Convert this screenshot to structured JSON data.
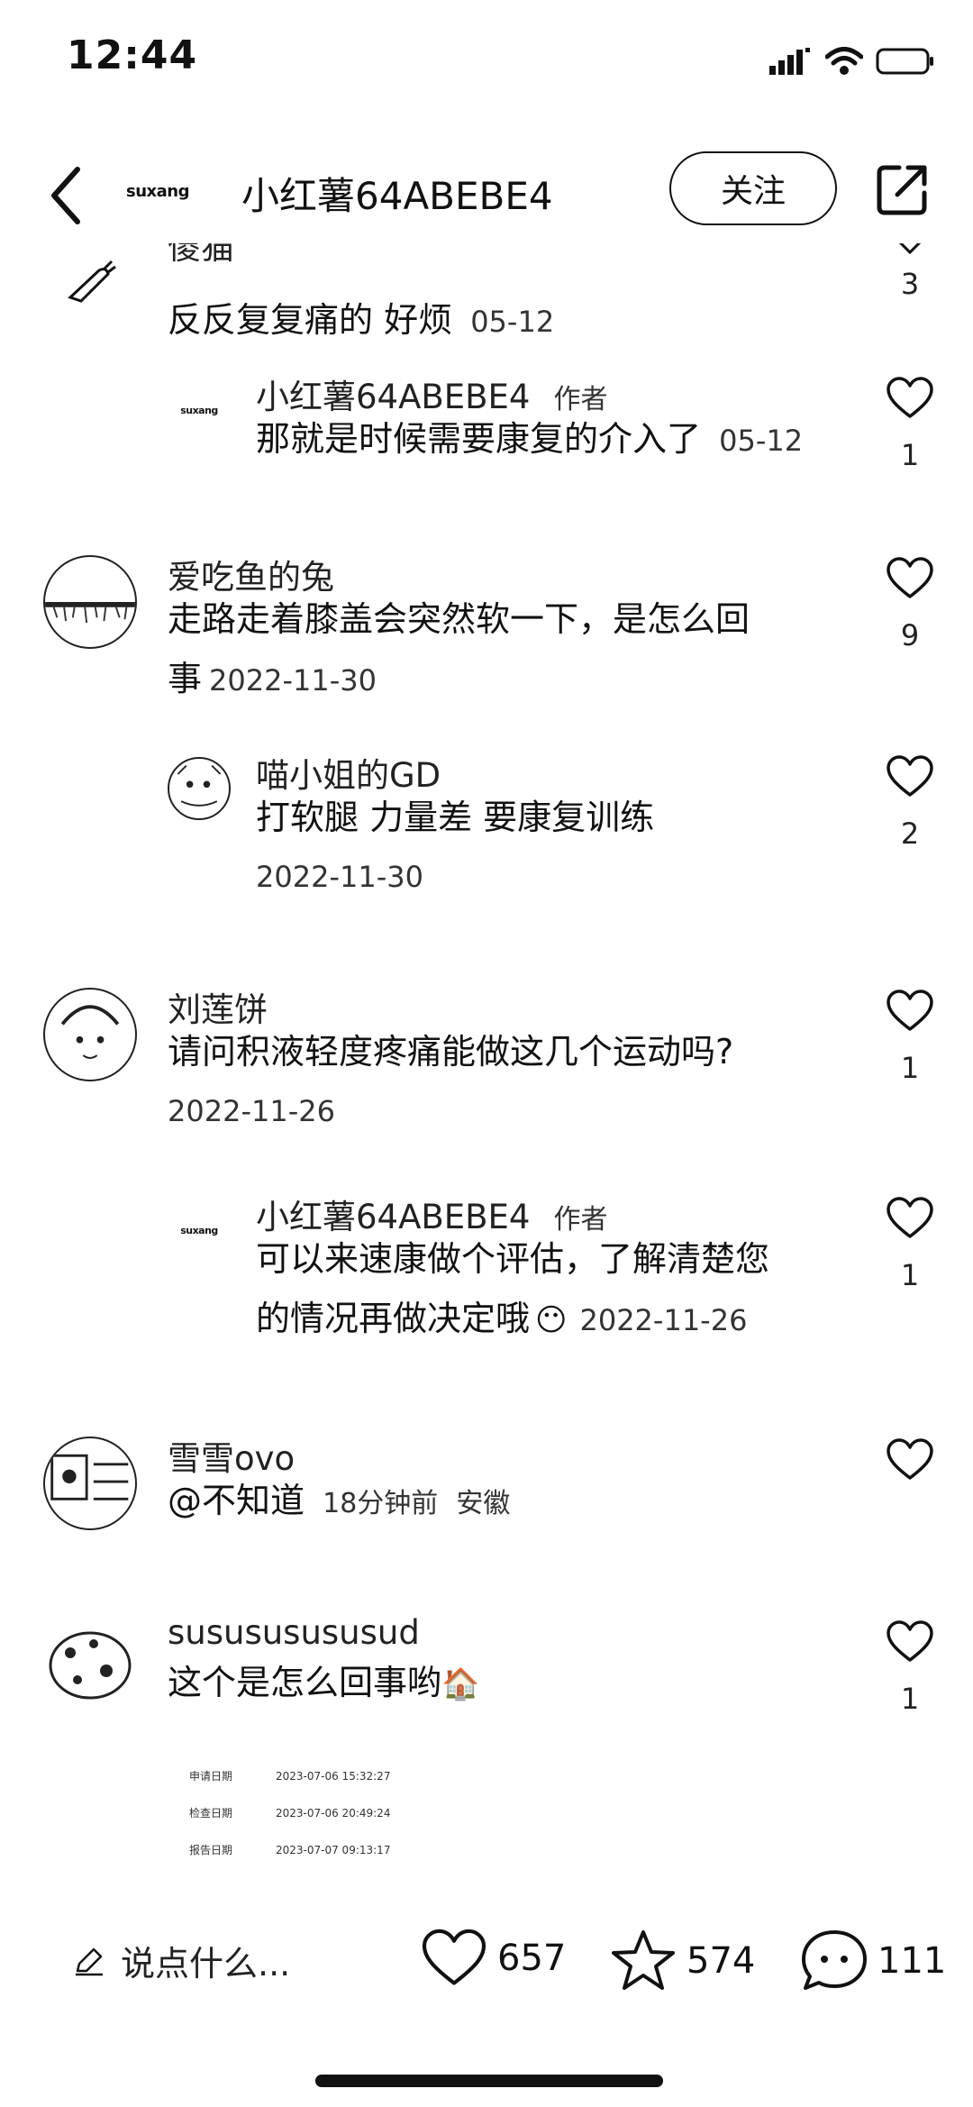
{
  "status_bar": {
    "time": "12:44"
  },
  "header": {
    "author_logo": "suxang",
    "author_name": "小红薯64ABEBE4",
    "follow_label": "关注"
  },
  "comments": [
    {
      "username": "傻猫",
      "text": "反反复复痛的 好烦",
      "date": "05-12",
      "likes": "3"
    },
    {
      "username": "小红薯64ABEBE4",
      "tag": "作者",
      "text": "那就是时候需要康复的介入了",
      "date": "05-12",
      "likes": "1"
    },
    {
      "username": "爱吃鱼的兔",
      "text_line1": "走路走着膝盖会突然软一下，是怎么回",
      "text_line2": "事",
      "date": "2022-11-30",
      "likes": "9"
    },
    {
      "username": "喵小姐的GD",
      "text": "打软腿 力量差 要康复训练",
      "date": "2022-11-30",
      "likes": "2"
    },
    {
      "username": "刘莲饼",
      "text": "请问积液轻度疼痛能做这几个运动吗?",
      "date": "2022-11-26",
      "likes": "1"
    },
    {
      "username": "小红薯64ABEBE4",
      "tag": "作者",
      "text_line1": "可以来速康做个评估，了解清楚您",
      "text_line2": "的情况再做决定哦",
      "date": "2022-11-26",
      "likes": "1"
    },
    {
      "username": "雪雪ovo",
      "text": "@不知道",
      "date": "18分钟前",
      "location": "安徽"
    },
    {
      "username": "susususususud",
      "text": "这个是怎么回事哟",
      "likes": "1"
    }
  ],
  "image_table": [
    {
      "label": "申请日期",
      "value": "2023-07-06 15:32:27"
    },
    {
      "label": "检查日期",
      "value": "2023-07-06 20:49:24"
    },
    {
      "label": "报告日期",
      "value": "2023-07-07 09:13:17"
    }
  ],
  "bottom_bar": {
    "input_placeholder": "说点什么...",
    "likes": "657",
    "favorites": "574",
    "comments": "111"
  }
}
